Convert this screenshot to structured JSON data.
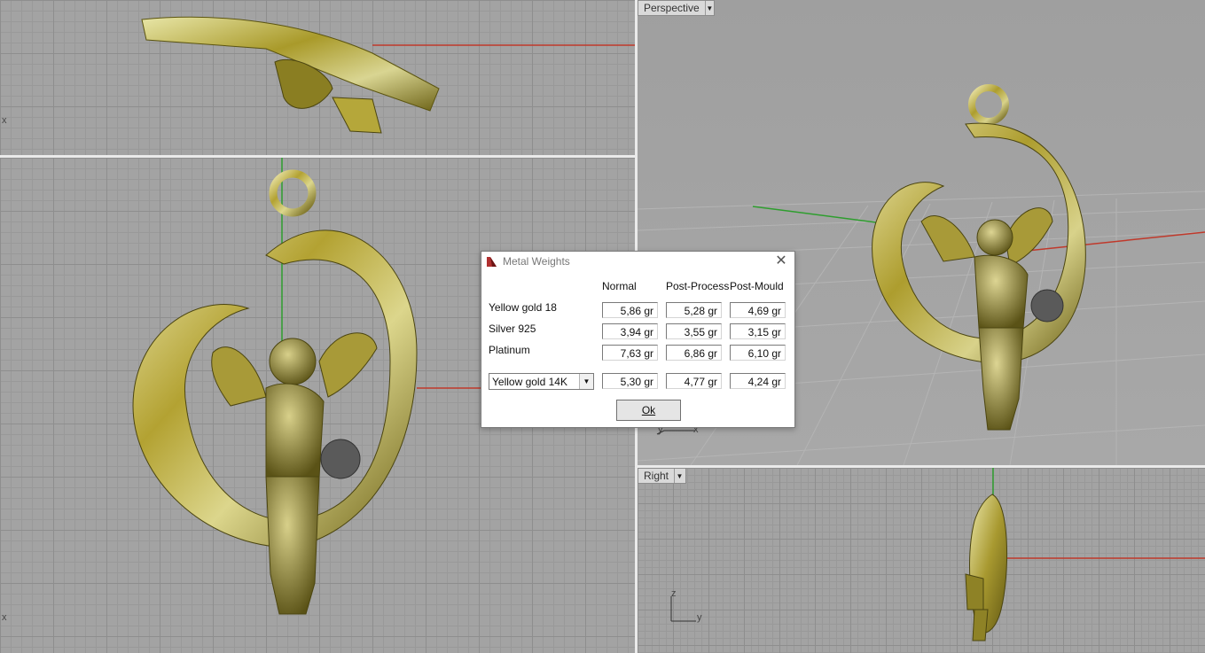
{
  "viewports": {
    "top": {
      "axis_label": "x"
    },
    "front": {
      "axis_label": "x"
    },
    "perspective": {
      "label": "Perspective",
      "axis_y": "y",
      "axis_x": "x"
    },
    "right": {
      "label": "Right",
      "axis_z": "z",
      "axis_y": "y"
    }
  },
  "dialog": {
    "title": "Metal Weights",
    "columns": [
      "Normal",
      "Post-Process",
      "Post-Mould"
    ],
    "rows": [
      {
        "label": "Yellow gold 18",
        "values": [
          "5,86 gr",
          "5,28 gr",
          "4,69 gr"
        ]
      },
      {
        "label": "Silver 925",
        "values": [
          "3,94 gr",
          "3,55 gr",
          "3,15 gr"
        ]
      },
      {
        "label": "Platinum",
        "values": [
          "7,63 gr",
          "6,86 gr",
          "6,10 gr"
        ]
      }
    ],
    "custom_row": {
      "selected_metal": "Yellow gold 14K",
      "values": [
        "5,30 gr",
        "4,77 gr",
        "4,24 gr"
      ]
    },
    "ok_label": "Ok"
  },
  "colors": {
    "axis_x": "#c0392b",
    "axis_y": "#2e9e2e",
    "metal": "#b8a434",
    "gem": "#555555"
  }
}
